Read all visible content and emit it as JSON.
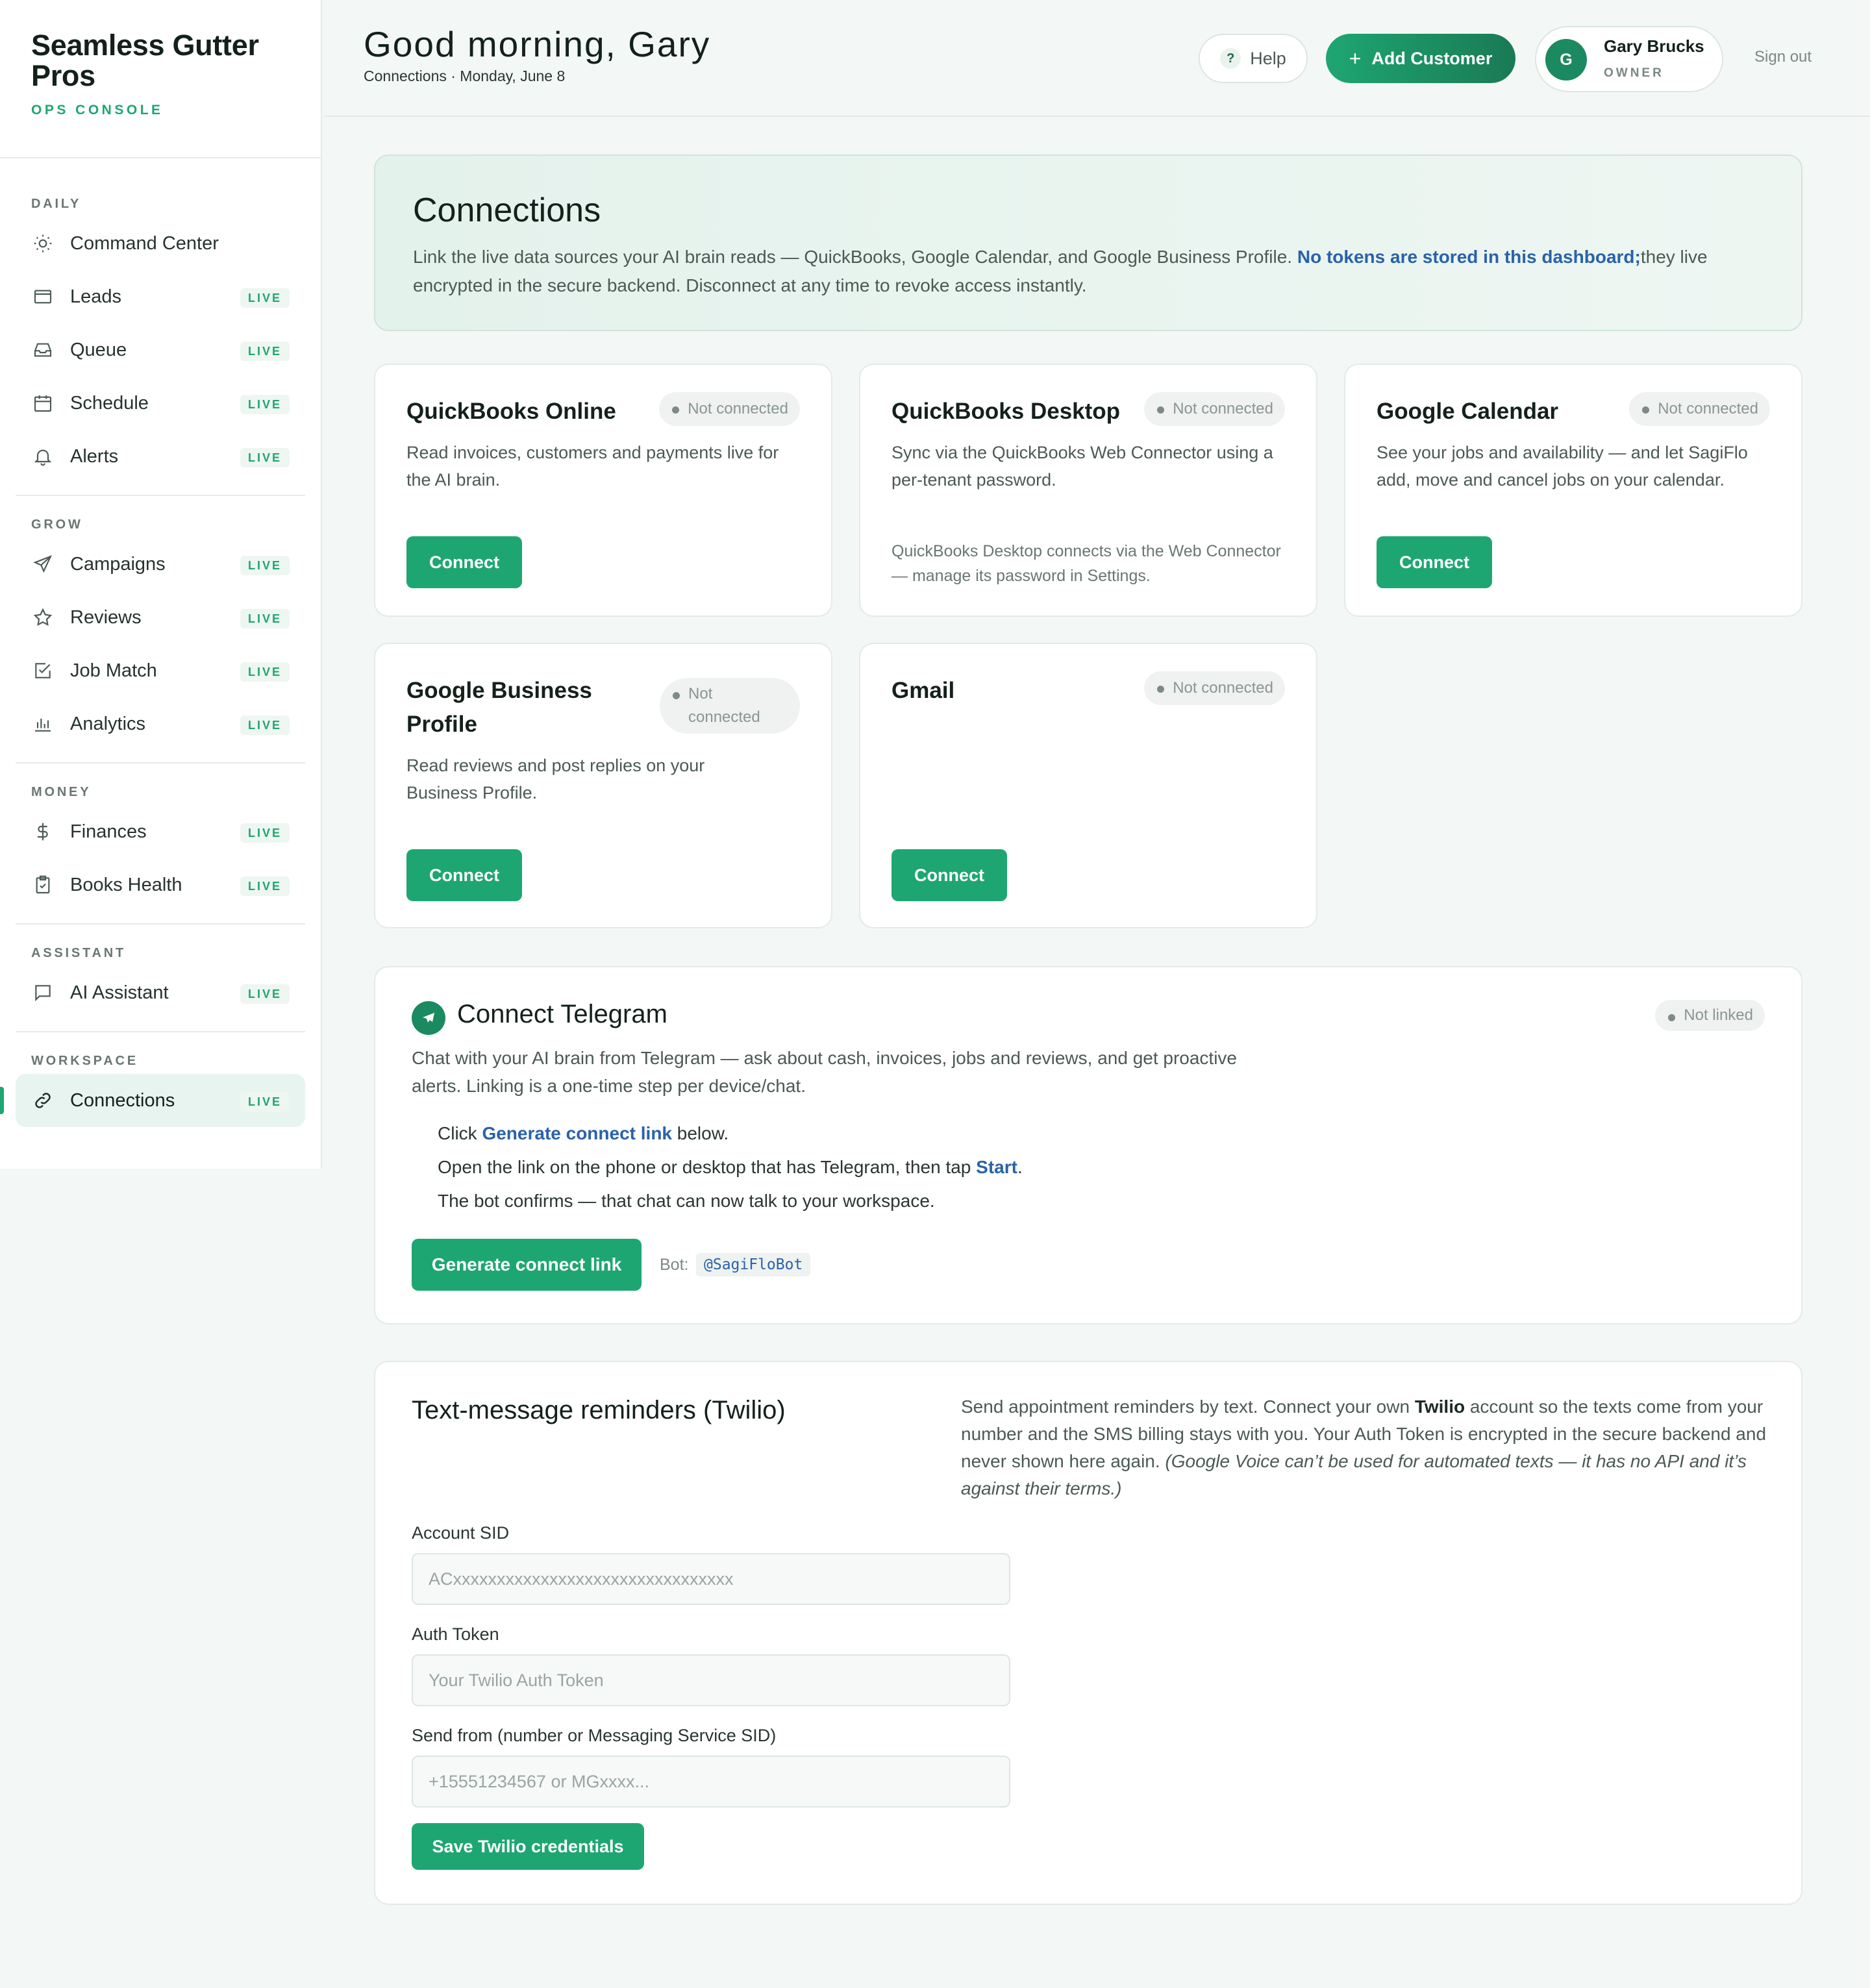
{
  "brand": {
    "name": "Seamless Gutter Pros",
    "subtitle": "OPS CONSOLE"
  },
  "sidebar": {
    "sections": [
      {
        "title": "DAILY",
        "items": [
          {
            "label": "Command Center",
            "icon": "sun-icon",
            "live": ""
          },
          {
            "label": "Leads",
            "icon": "mail-icon",
            "live": "LIVE"
          },
          {
            "label": "Queue",
            "icon": "inbox-icon",
            "live": "LIVE"
          },
          {
            "label": "Schedule",
            "icon": "calendar-icon",
            "live": "LIVE"
          },
          {
            "label": "Alerts",
            "icon": "bell-icon",
            "live": "LIVE"
          }
        ]
      },
      {
        "title": "GROW",
        "items": [
          {
            "label": "Campaigns",
            "icon": "send-icon",
            "live": "LIVE"
          },
          {
            "label": "Reviews",
            "icon": "star-icon",
            "live": "LIVE"
          },
          {
            "label": "Job Match",
            "icon": "check-square-icon",
            "live": "LIVE"
          },
          {
            "label": "Analytics",
            "icon": "bar-chart-icon",
            "live": "LIVE"
          }
        ]
      },
      {
        "title": "MONEY",
        "items": [
          {
            "label": "Finances",
            "icon": "dollar-icon",
            "live": "LIVE"
          },
          {
            "label": "Books Health",
            "icon": "clipboard-icon",
            "live": "LIVE"
          }
        ]
      },
      {
        "title": "ASSISTANT",
        "items": [
          {
            "label": "AI Assistant",
            "icon": "chat-icon",
            "live": "LIVE"
          }
        ]
      },
      {
        "title": "WORKSPACE",
        "items": [
          {
            "label": "Connections",
            "icon": "link-icon",
            "live": "LIVE",
            "active": true
          }
        ]
      }
    ]
  },
  "header": {
    "greeting": "Good morning, Gary",
    "breadcrumb": "Connections · Monday, June 8",
    "help_label": "Help",
    "help_icon": "?",
    "add_label": "Add Customer",
    "user": {
      "initial": "G",
      "name": "Gary Brucks",
      "role": "OWNER"
    },
    "signout": "Sign out"
  },
  "banner": {
    "title": "Connections",
    "desc_pre": "Link the live data sources your AI brain reads — QuickBooks, Google Calendar, and Google Business Profile. ",
    "desc_bold": "No tokens are stored in this dashboard;",
    "desc_post": "they live encrypted in the secure backend. Disconnect at any time to revoke access instantly."
  },
  "cards": {
    "qbo": {
      "title": "QuickBooks Online",
      "status": "Not connected",
      "desc": "Read invoices, customers and payments live for the AI brain.",
      "button": "Connect"
    },
    "qbd": {
      "title": "QuickBooks Desktop",
      "status": "Not connected",
      "desc": "Sync via the QuickBooks Web Connector using a per-tenant password.",
      "note": "QuickBooks Desktop connects via the Web Connector — manage its password in Settings."
    },
    "gcal": {
      "title": "Google Calendar",
      "status": "Not connected",
      "desc": "See your jobs and availability — and let SagiFlo add, move and cancel jobs on your calendar.",
      "button": "Connect"
    },
    "gbp": {
      "title": "Google Business Profile",
      "status": "Not connected",
      "desc": "Read reviews and post replies on your Business Profile.",
      "button": "Connect"
    },
    "gmail": {
      "title": "Gmail",
      "status": "Not connected",
      "button": "Connect"
    }
  },
  "telegram": {
    "title": "Connect Telegram",
    "status": "Not linked",
    "desc": "Chat with your AI brain from Telegram — ask about cash, invoices, jobs and reviews, and get proactive alerts. Linking is a one-time step per device/chat.",
    "step1_pre": "Click ",
    "step1_bold": "Generate connect link",
    "step1_post": " below.",
    "step2_pre": "Open the link on the phone or desktop that has Telegram, then tap ",
    "step2_bold": "Start",
    "step2_post": ".",
    "step3": "The bot confirms — that chat can now talk to your workspace.",
    "button": "Generate connect link",
    "bot_label": "Bot:",
    "bot_handle": "@SagiFloBot"
  },
  "twilio": {
    "title": "Text-message reminders (Twilio)",
    "desc_pre": "Send appointment reminders by text. Connect your own ",
    "desc_bold": "Twilio",
    "desc_mid": " account so the texts come from your number and the SMS billing stays with you. Your Auth Token is encrypted in the secure backend and never shown here again. ",
    "desc_italic": "(Google Voice can’t be used for automated texts — it has no API and it’s against their terms.)",
    "fields": [
      {
        "label": "Account SID",
        "placeholder": "ACxxxxxxxxxxxxxxxxxxxxxxxxxxxxxxxx",
        "value": ""
      },
      {
        "label": "Auth Token",
        "placeholder": "Your Twilio Auth Token",
        "value": ""
      },
      {
        "label": "Send from (number or Messaging Service SID)",
        "placeholder": "+15551234567 or MGxxxx...",
        "value": ""
      }
    ],
    "button": "Save Twilio credentials"
  },
  "colors": {
    "accent": "#1ea672",
    "accent_dark": "#1a7a55",
    "link": "#2a62a8",
    "background": "#f3f7f5"
  }
}
